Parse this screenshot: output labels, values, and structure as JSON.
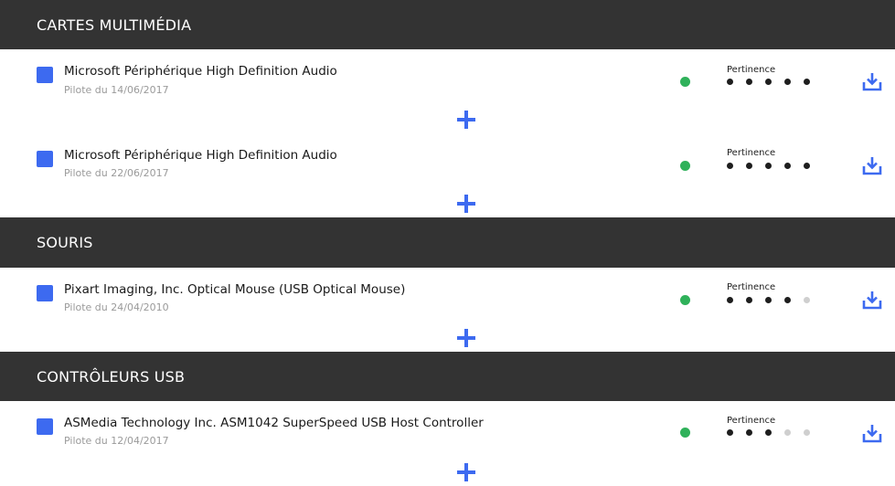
{
  "sections": [
    {
      "title": "CARTES MULTIMÉDIA",
      "drivers": [
        {
          "name": "Microsoft Périphérique High Definition Audio",
          "date": "Pilote du 14/06/2017",
          "pertinence_label": "Pertinence",
          "pertinence": 5,
          "pertinence_max": 5,
          "status_color": "#2fb15a"
        },
        {
          "name": "Microsoft Périphérique High Definition Audio",
          "date": "Pilote du 22/06/2017",
          "pertinence_label": "Pertinence",
          "pertinence": 5,
          "pertinence_max": 5,
          "status_color": "#2fb15a"
        }
      ]
    },
    {
      "title": "SOURIS",
      "drivers": [
        {
          "name": "Pixart Imaging, Inc. Optical Mouse (USB Optical Mouse)",
          "date": "Pilote du 24/04/2010",
          "pertinence_label": "Pertinence",
          "pertinence": 4,
          "pertinence_max": 5,
          "status_color": "#2fb15a"
        }
      ]
    },
    {
      "title": "CONTRÔLEURS USB",
      "drivers": [
        {
          "name": "ASMedia Technology Inc. ASM1042 SuperSpeed USB Host Controller",
          "date": "Pilote du 12/04/2017",
          "pertinence_label": "Pertinence",
          "pertinence": 3,
          "pertinence_max": 5,
          "status_color": "#2fb15a"
        }
      ]
    }
  ],
  "icons": {
    "checkbox": "checkbox-icon",
    "status": "status-dot-icon",
    "download": "download-icon",
    "expand": "plus-icon"
  },
  "colors": {
    "accent": "#3d6af0",
    "header_bg": "#333333",
    "status_ok": "#2fb15a",
    "rating_on": "#1e1e1e",
    "rating_off": "#cfcfcf"
  }
}
